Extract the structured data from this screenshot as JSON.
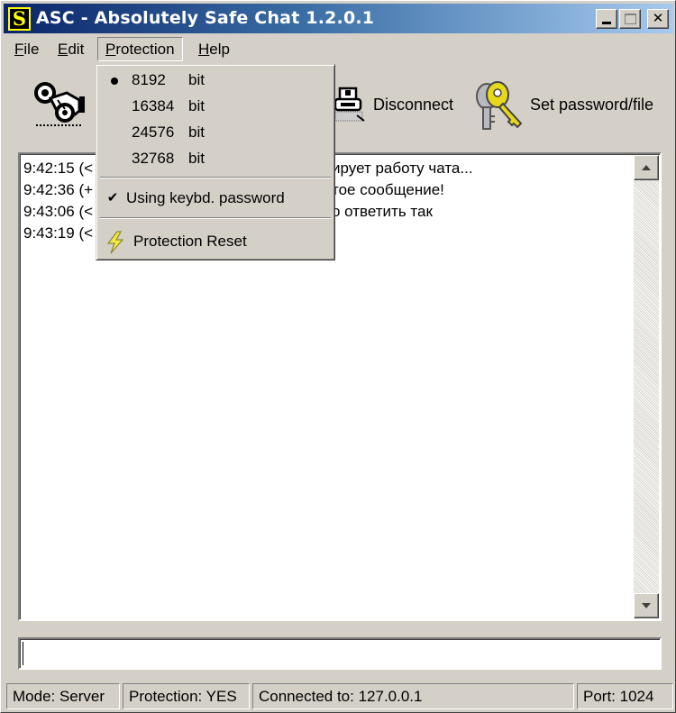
{
  "window": {
    "app_icon_letter": "S",
    "title": "ASC - Absolutely Safe Chat 1.2.0.1",
    "controls": [
      "minimize",
      "maximize",
      "close"
    ]
  },
  "menubar": {
    "items": [
      {
        "label": "File",
        "mnemonic": "F",
        "rest": "ile"
      },
      {
        "label": "Edit",
        "mnemonic": "E",
        "rest": "dit"
      },
      {
        "label": "Protection",
        "mnemonic": "P",
        "rest": "rotection",
        "active": true
      },
      {
        "label": "Help",
        "mnemonic": "H",
        "rest": "elp"
      }
    ]
  },
  "protection_menu": {
    "key_sizes": [
      {
        "value": "8192",
        "unit": "bit",
        "selected": true
      },
      {
        "value": "16384",
        "unit": "bit",
        "selected": false
      },
      {
        "value": "24576",
        "unit": "bit",
        "selected": false
      },
      {
        "value": "32768",
        "unit": "bit",
        "selected": false
      }
    ],
    "keyboard_password": {
      "label": "Using keybd. password",
      "checked": true,
      "check_glyph": "✔"
    },
    "reset": {
      "label": "Protection Reset",
      "icon": "lightning-icon"
    }
  },
  "toolbar": {
    "connect": {
      "icon": "connect-plug-icon",
      "label": ""
    },
    "disconnect": {
      "icon": "disconnect-icon",
      "label": "Disconnect"
    },
    "set_password": {
      "icon": "keys-icon",
      "label": "Set password/file"
    }
  },
  "chat_log": {
    "lines": [
      {
        "left": "9:42:15 (<",
        "right": "ирует работу чата..."
      },
      {
        "left": "9:42:36 (+",
        "right": "тое сообщение!"
      },
      {
        "left": "9:43:06 (<",
        "right": "о ответить так"
      },
      {
        "left": "9:43:19 (<",
        "right": ""
      }
    ]
  },
  "message_input": {
    "value": "",
    "placeholder": ""
  },
  "statusbar": {
    "mode": "Mode: Server",
    "protection": "Protection: YES",
    "connected": "Connected to: 127.0.0.1",
    "port": "Port: 1024"
  },
  "colors": {
    "titlebar_start": "#0a246a",
    "titlebar_end": "#a6caf0",
    "face": "#d4d0c8",
    "app_icon_fg": "#ffff00",
    "key_yellow": "#e8d81c"
  }
}
